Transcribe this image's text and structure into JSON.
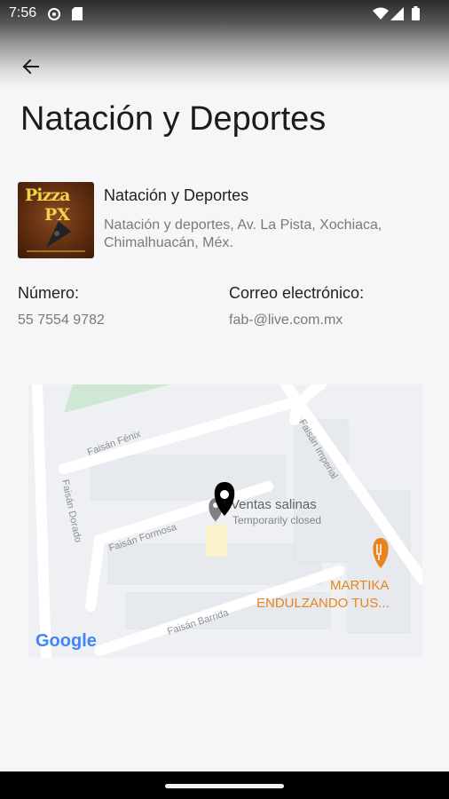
{
  "status_bar": {
    "time": "7:56"
  },
  "header": {
    "title": "Natación y Deportes"
  },
  "place": {
    "logo_text_line1": "Pizza",
    "logo_text_line2": "PX",
    "name": "Natación y Deportes",
    "address": "Natación y deportes, Av. La Pista, Xochiaca, Chimalhuacán, Méx."
  },
  "contact": {
    "phone_label": "Número:",
    "phone_value": "55 7554 9782",
    "email_label": "Correo electrónico:",
    "email_value": "fab-@live.com.mx"
  },
  "map": {
    "streets": [
      "Faisán Fénix",
      "Faisán Dorado",
      "Faisán Imperial",
      "Faisán Formosa",
      "Faisán Barrida"
    ],
    "poi_1_name": "Ventas salinas",
    "poi_1_status": "Temporarily closed",
    "poi_2_line1": "MARTIKA",
    "poi_2_line2": "ENDULZANDO TUS...",
    "attribution": "Google"
  },
  "colors": {
    "accent_orange": "#e8841f",
    "marker": "#000000"
  }
}
